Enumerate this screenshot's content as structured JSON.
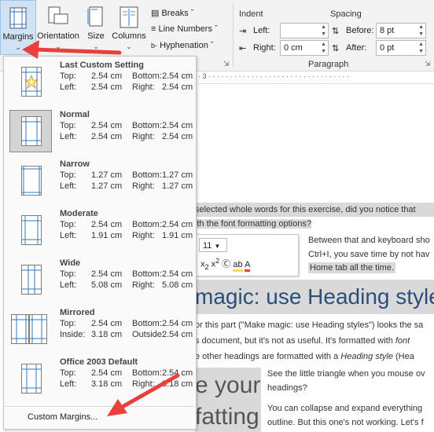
{
  "ribbon": {
    "margins_label": "Margins",
    "orientation_label": "Orientation",
    "size_label": "Size",
    "columns_label": "Columns",
    "breaks_label": "Breaks",
    "line_numbers_label": "Line Numbers",
    "hyphenation_label": "Hyphenation",
    "indent": {
      "title": "Indent",
      "left_label": "Left:",
      "left_value": "",
      "right_label": "Right:",
      "right_value": "0 cm"
    },
    "spacing": {
      "title": "Spacing",
      "before_label": "Before:",
      "before_value": "8 pt",
      "after_label": "After:",
      "after_value": "0 pt"
    },
    "paragraph_group": "Paragraph"
  },
  "ruler": {
    "text": "· 3 · · · · · · · · · · · · · · · · · · · · · · · · · · · · · · · · ·"
  },
  "menu": {
    "items": [
      {
        "name": "Last Custom Setting",
        "r1l": "Top:",
        "r1v": "2.54 cm",
        "r1l2": "Bottom:",
        "r1v2": "2.54 cm",
        "r2l": "Left:",
        "r2v": "2.54 cm",
        "r2l2": "Right:",
        "r2v2": "2.54 cm"
      },
      {
        "name": "Normal",
        "r1l": "Top:",
        "r1v": "2.54 cm",
        "r1l2": "Bottom:",
        "r1v2": "2.54 cm",
        "r2l": "Left:",
        "r2v": "2.54 cm",
        "r2l2": "Right:",
        "r2v2": "2.54 cm"
      },
      {
        "name": "Narrow",
        "r1l": "Top:",
        "r1v": "1.27 cm",
        "r1l2": "Bottom:",
        "r1v2": "1.27 cm",
        "r2l": "Left:",
        "r2v": "1.27 cm",
        "r2l2": "Right:",
        "r2v2": "1.27 cm"
      },
      {
        "name": "Moderate",
        "r1l": "Top:",
        "r1v": "2.54 cm",
        "r1l2": "Bottom:",
        "r1v2": "2.54 cm",
        "r2l": "Left:",
        "r2v": "1.91 cm",
        "r2l2": "Right:",
        "r2v2": "1.91 cm"
      },
      {
        "name": "Wide",
        "r1l": "Top:",
        "r1v": "2.54 cm",
        "r1l2": "Bottom:",
        "r1v2": "2.54 cm",
        "r2l": "Left:",
        "r2v": "5.08 cm",
        "r2l2": "Right:",
        "r2v2": "5.08 cm"
      },
      {
        "name": "Mirrored",
        "r1l": "Top:",
        "r1v": "2.54 cm",
        "r1l2": "Bottom:",
        "r1v2": "2.54 cm",
        "r2l": "Inside:",
        "r2v": "3.18 cm",
        "r2l2": "Outside:",
        "r2v2": "2.54 cm"
      },
      {
        "name": "Office 2003 Default",
        "r1l": "Top:",
        "r1v": "2.54 cm",
        "r1l2": "Bottom:",
        "r1v2": "2.54 cm",
        "r2l": "Left:",
        "r2v": "3.18 cm",
        "r2l2": "Right:",
        "r2v2": "3.18 cm"
      }
    ],
    "custom_label": "Custom Margins..."
  },
  "document": {
    "line1": "selected whole words for this exercise, did you notice that",
    "line2": "ith the font formatting options?",
    "side1": "Between that and keyboard sho",
    "side2": "Ctrl+I, you save time by not hav",
    "side3": "Home tab all the time.",
    "heading": "magic: use Heading styles",
    "para1": "or this part (\"Make magic: use Heading styles\") looks the sa",
    "para2a": "s document, but it's not as useful. It's formatted with ",
    "para2b": "font",
    "para3a": "e other headings are formatted with a ",
    "para3b": "Heading style",
    "para3c": " (Hea",
    "big1": "e your",
    "big2": "fatting",
    "right1": "See the little triangle when you mouse ov",
    "right2": "headings?",
    "right3": "You can collapse and expand everything",
    "right4": "outline. But this one's not working. Let's f",
    "mini_size": "11"
  },
  "colors": {
    "accent": "#e8413b",
    "selection": "#cfe3f4",
    "highlight": "#d9d9d9"
  }
}
